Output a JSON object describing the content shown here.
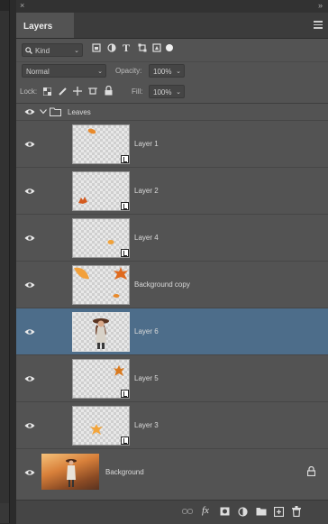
{
  "window": {
    "close_glyph": "×",
    "collapse_glyph": "»"
  },
  "panel": {
    "tab": "Layers",
    "menu_icon": "panel-menu-icon"
  },
  "filter": {
    "kind": "Kind",
    "search_icon": "search-icon",
    "glyphs": [
      "T"
    ]
  },
  "blend": {
    "mode": "Normal",
    "opacity_label": "Opacity:",
    "opacity_value": "100%"
  },
  "lock": {
    "label": "Lock:",
    "fill_label": "Fill:",
    "fill_value": "100%"
  },
  "group": {
    "name": "Leaves"
  },
  "layers": [
    {
      "name": "Layer 1",
      "selected": false,
      "leaf_color": "#e88a2c"
    },
    {
      "name": "Layer 2",
      "selected": false,
      "leaf_color": "#d45b1f"
    },
    {
      "name": "Layer 4",
      "selected": false,
      "leaf_color": "#f0a23a"
    },
    {
      "name": "Background copy",
      "selected": false,
      "leaf_color": "#e06a1e"
    },
    {
      "name": "Layer 6",
      "selected": true,
      "leaf_color": "#7a4a2e"
    },
    {
      "name": "Layer 5",
      "selected": false,
      "leaf_color": "#d97a20"
    },
    {
      "name": "Layer 3",
      "selected": false,
      "leaf_color": "#f2a53c"
    }
  ],
  "background_layer": {
    "name": "Background",
    "lock_icon": "lock-icon"
  },
  "bottom_bar": {
    "fx_label": "fx",
    "icons": [
      "link-layers-icon",
      "fx-icon",
      "mask-icon",
      "adjustment-icon",
      "folder-icon",
      "new-layer-icon",
      "trash-icon"
    ]
  }
}
